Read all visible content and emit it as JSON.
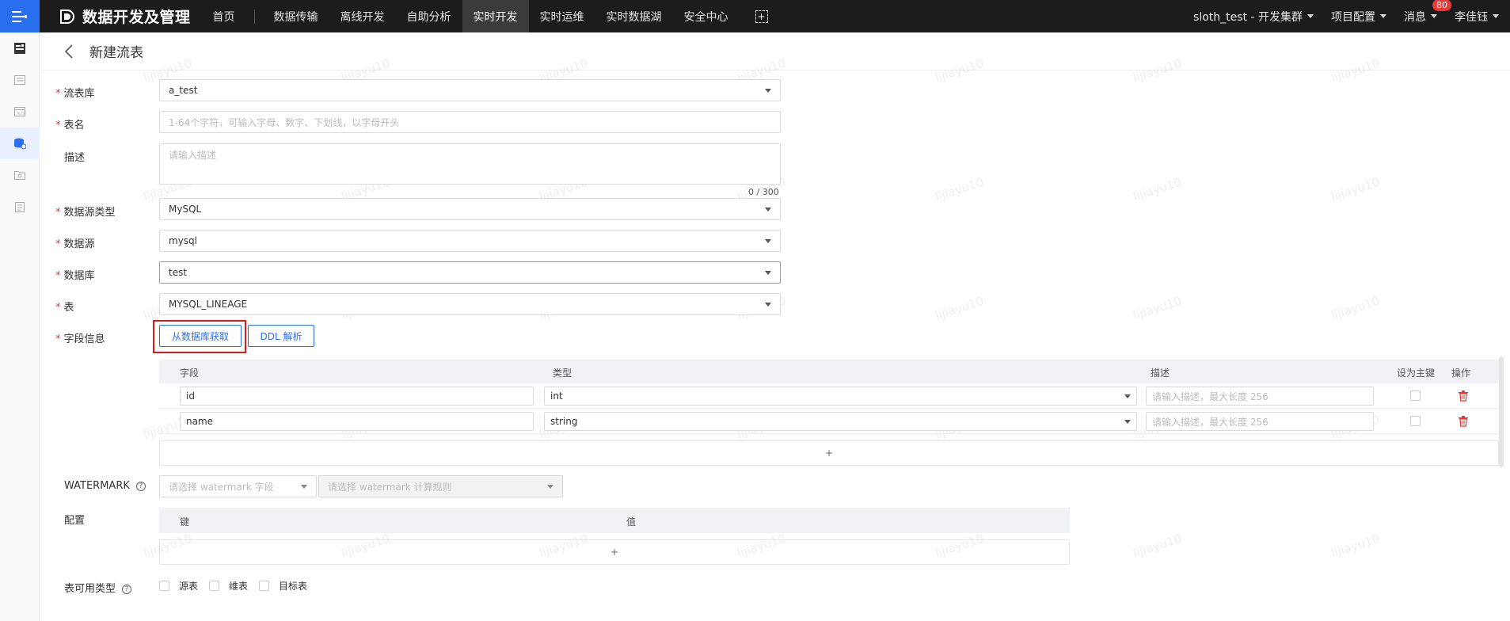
{
  "topbar": {
    "brand_title": "数据开发及管理",
    "nav": [
      "首页",
      "数据传输",
      "离线开发",
      "自助分析",
      "实时开发",
      "实时运维",
      "实时数据湖",
      "安全中心"
    ],
    "active_nav": "实时开发",
    "cluster": "sloth_test - 开发集群",
    "project_config": "项目配置",
    "messages": "消息",
    "message_count": "80",
    "user": "李佳钰"
  },
  "header": {
    "title": "新建流表"
  },
  "form": {
    "library": {
      "label": "流表库",
      "value": "a_test"
    },
    "table_name": {
      "label": "表名",
      "placeholder": "1-64个字符，可输入字母、数字、下划线，以字母开头"
    },
    "description": {
      "label": "描述",
      "placeholder": "请输入描述",
      "counter": "0 / 300"
    },
    "datasource_type": {
      "label": "数据源类型",
      "value": "MySQL"
    },
    "datasource": {
      "label": "数据源",
      "value": "mysql"
    },
    "database": {
      "label": "数据库",
      "value": "test"
    },
    "table": {
      "label": "表",
      "value": "MYSQL_LINEAGE"
    },
    "fields_info": {
      "label": "字段信息",
      "fetch_button": "从数据库获取",
      "ddl_button": "DDL 解析",
      "columns": [
        "字段",
        "类型",
        "描述",
        "设为主键",
        "操作"
      ],
      "rows": [
        {
          "name": "id",
          "type": "int",
          "desc_placeholder": "请输入描述，最大长度 256"
        },
        {
          "name": "name",
          "type": "string",
          "desc_placeholder": "请输入描述，最大长度 256"
        }
      ],
      "add": "+"
    },
    "watermark": {
      "label": "WATERMARK",
      "field_placeholder": "请选择 watermark 字段",
      "rule_placeholder": "请选择 watermark 计算规则"
    },
    "config": {
      "label": "配置",
      "columns": [
        "键",
        "值"
      ],
      "add": "+"
    },
    "usage_type": {
      "label": "表可用类型",
      "options": [
        "源表",
        "维表",
        "目标表"
      ]
    }
  },
  "watermark_text": "lijiayu10",
  "colors": {
    "accent": "#2f6ef0",
    "highlight": "#e01a1a",
    "topbar": "#1c1c1c"
  }
}
